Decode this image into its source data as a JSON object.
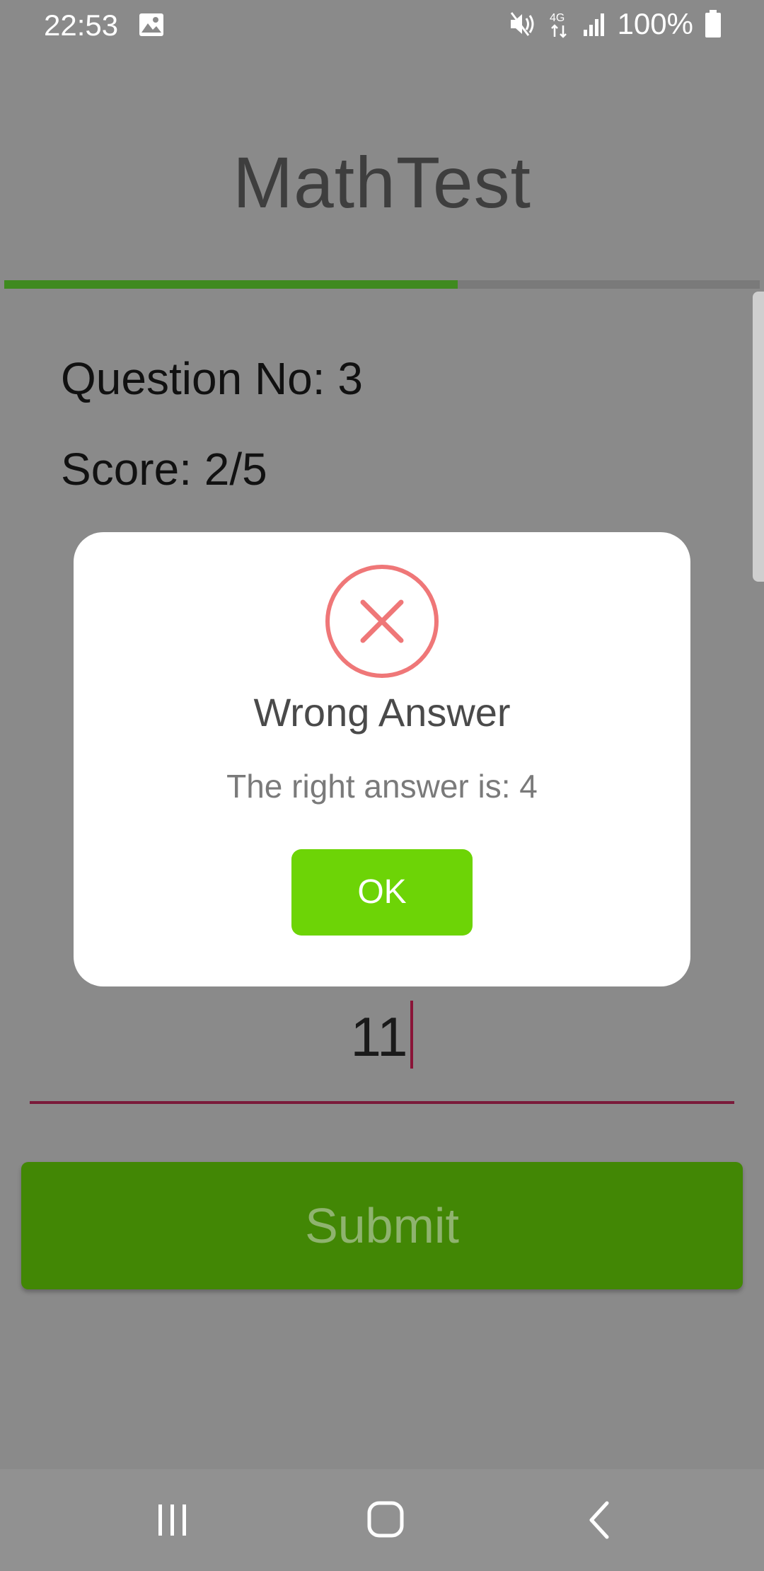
{
  "status_bar": {
    "time": "22:53",
    "battery": "100%",
    "network": "4G",
    "icons": [
      "image-icon",
      "mute-icon",
      "network-4g-icon",
      "signal-icon",
      "battery-icon"
    ]
  },
  "app": {
    "title": "MathTest",
    "progress_fraction": 0.6,
    "colors": {
      "background_dim": "#8a8a8a",
      "progress": "#3f8a1f",
      "submit": "#428705",
      "ok": "#6dd406",
      "error": "#ef7778",
      "input_accent": "#8a1538"
    }
  },
  "quiz": {
    "question_label": "Question No: 3",
    "score_label": "Score: 2/5",
    "answer_value": "11",
    "submit_label": "Submit"
  },
  "dialog": {
    "icon": "error-x-icon",
    "title": "Wrong Answer",
    "message": "The right answer is: 4",
    "ok_label": "OK"
  },
  "nav_bar": {
    "buttons": [
      "recent-apps-icon",
      "home-icon",
      "back-icon"
    ]
  }
}
